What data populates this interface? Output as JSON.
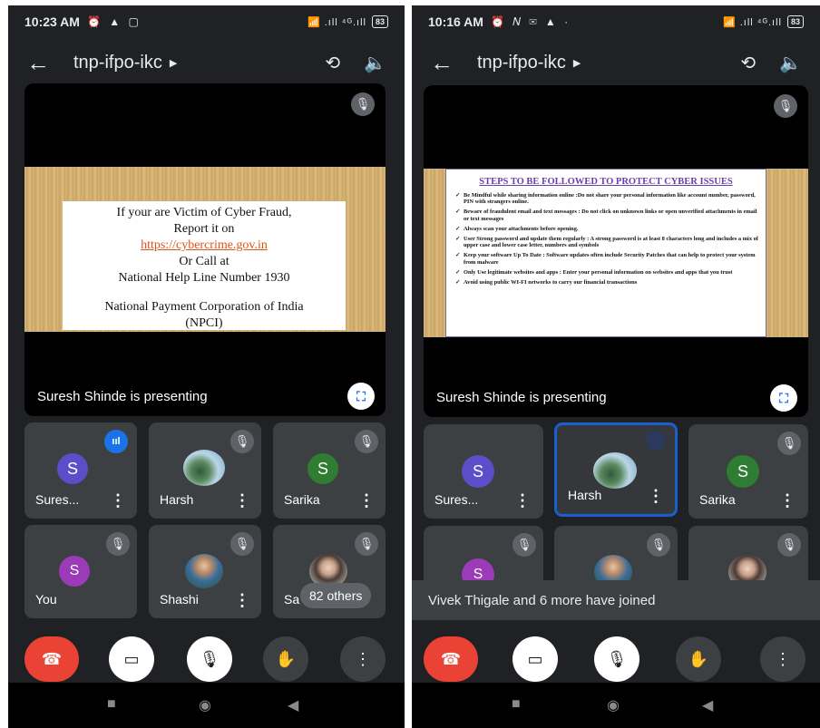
{
  "left": {
    "status": {
      "time": "10:23 AM",
      "icons": "⏰ ▲ ▢",
      "signal": "📶 .ıll ⁴ᴳ.ıll",
      "battery": "83"
    },
    "meeting_title": "tnp-ifpo-ikc",
    "slide": {
      "line1": "If your are Victim of Cyber Fraud,",
      "line2": "Report it on",
      "url": "https://cybercrime.gov.in",
      "line3": "Or Call at",
      "line4": "National Help Line Number 1930",
      "line5": "National Payment Corporation of India",
      "line6": "(NPCI)"
    },
    "presenting": "Suresh Shinde is presenting",
    "tiles": [
      {
        "name": "Sures...",
        "avatar": "S",
        "color": "#5c4ec9"
      },
      {
        "name": "Harsh"
      },
      {
        "name": "Sarika",
        "avatar": "S",
        "color": "#2e7d32"
      },
      {
        "name": "You",
        "avatar": "S",
        "color": "#9b3bb8"
      },
      {
        "name": "Shashi"
      },
      {
        "name": "Sa"
      }
    ],
    "others": "82 others"
  },
  "right": {
    "status": {
      "time": "10:16 AM",
      "icons": "⏰ 𝑁 ✉ ▲ ·",
      "signal": "📶 .ıll ⁴ᴳ.ıll",
      "battery": "83"
    },
    "meeting_title": "tnp-ifpo-ikc",
    "slide": {
      "heading": "STEPS TO BE FOLLOWED TO PROTECT CYBER ISSUES",
      "items": [
        "Be Mindful while sharing information online :Do not share your personal information like account number, password, PIN with strangers online.",
        "Beware of fraudulent email and text messages : Do not click on unknown links or open unverified attachments in email or text messages",
        "Always scan your attachments before opening.",
        "User Strong password and update them regularly : A strong password is at least 8 characters long and includes a mix of upper case and lower case letter, numbers and symbols",
        "Keep your software Up To Date : Software updates often include Security Patches that can help to protect your system from malware",
        "Only Use legitimate websites and apps : Enter your personal information on websites and apps that you trust",
        "Avoid using public WI-FI networks to carry our financial transactions"
      ]
    },
    "presenting": "Suresh Shinde is presenting",
    "tiles": [
      {
        "name": "Sures...",
        "avatar": "S",
        "color": "#5c4ec9"
      },
      {
        "name": "Harsh"
      },
      {
        "name": "Sarika",
        "avatar": "S",
        "color": "#2e7d32"
      },
      {
        "avatar": "S",
        "color": "#9b3bb8"
      }
    ],
    "toast": "Vivek Thigale and 6 more have joined"
  },
  "icons": {
    "back": "←",
    "caret": "▶",
    "switch_camera": "⟲",
    "speaker": "🔈",
    "mic_off": "🎙",
    "fullscreen": "⛶",
    "end_call": "☎",
    "camera_off": "▭",
    "raise_hand": "✋",
    "more": "⋮",
    "nav_square": "■",
    "nav_circle": "◉",
    "nav_back": "◀"
  }
}
